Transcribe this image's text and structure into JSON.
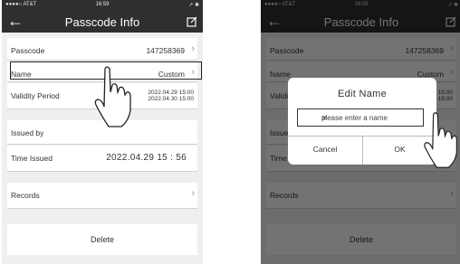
{
  "status": {
    "carrier": "●●●●○ AT&T",
    "time": "16:59",
    "right": "↗ ✱"
  },
  "nav": {
    "title": "Passcode Info",
    "back_icon": "back-arrow-icon",
    "edit_icon": "edit-icon"
  },
  "rows": {
    "passcode": {
      "label": "Passcode",
      "value": "147258369"
    },
    "name": {
      "label": "Name",
      "value": "Custom"
    },
    "validity": {
      "label": "Validity Period",
      "start": "2022.04.29 15:00",
      "end": "2022.04.30 15:00"
    },
    "issued_by": {
      "label": "Issued by"
    },
    "time_issued": {
      "label": "Time Issued",
      "value": "2022.04.29 15 : 56"
    },
    "records": {
      "label": "Records"
    },
    "delete": {
      "label": "Delete"
    }
  },
  "right_rows": {
    "validity_start_tail": "15:00",
    "validity_end_tail": "15:00",
    "validity_label_partial": "Valid",
    "issued_partial": "Issu",
    "time_partial": "Time"
  },
  "dialog": {
    "title": "Edit Name",
    "placeholder": "please enter a name",
    "clear": "✕",
    "cancel": "Cancel",
    "ok": "OK"
  },
  "colors": {
    "navbar": "#2f2f2f",
    "background": "#efefef",
    "overlay": "rgba(0,0,0,0.55)"
  }
}
